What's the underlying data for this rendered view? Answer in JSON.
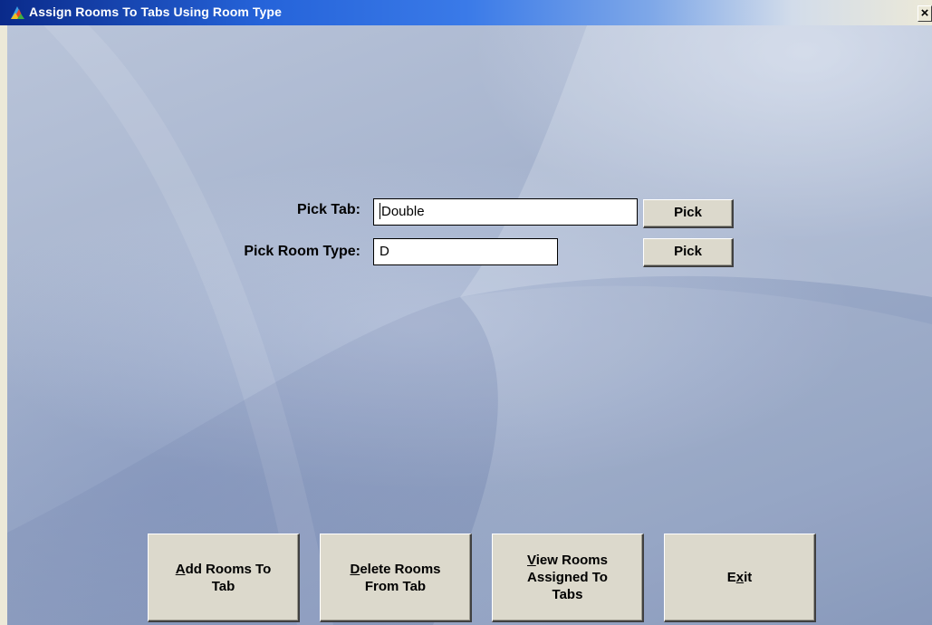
{
  "window": {
    "title": "Assign Rooms To Tabs Using Room Type",
    "close_glyph": "×"
  },
  "form": {
    "pick_tab_label": "Pick Tab:",
    "pick_tab_value": "Double",
    "pick_room_type_label": "Pick Room Type:",
    "pick_room_type_value": "D",
    "pick_button_label": "Pick"
  },
  "actions": {
    "add": {
      "mnemonic": "A",
      "rest_line1": "dd Rooms To",
      "line2": "Tab"
    },
    "delete": {
      "mnemonic": "D",
      "rest_line1": "elete Rooms",
      "line2": "From Tab"
    },
    "view": {
      "mnemonic": "V",
      "rest_line1": "iew Rooms",
      "line2": "Assigned To",
      "line3": "Tabs"
    },
    "exit": {
      "prefix": "E",
      "mnemonic": "x",
      "suffix": "it"
    }
  },
  "icons": {
    "app": "app-icon",
    "close": "close-icon"
  }
}
